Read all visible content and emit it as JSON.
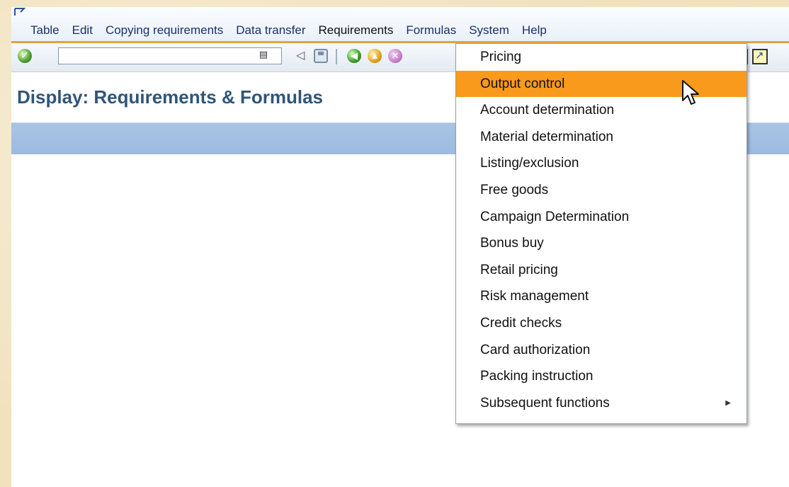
{
  "window": {
    "page_title": "Display: Requirements & Formulas"
  },
  "menubar": {
    "items": [
      {
        "label": "Table"
      },
      {
        "label": "Edit"
      },
      {
        "label": "Copying requirements"
      },
      {
        "label": "Data transfer"
      },
      {
        "label": "Requirements"
      },
      {
        "label": "Formulas"
      },
      {
        "label": "System"
      },
      {
        "label": "Help"
      }
    ],
    "active_index": 4
  },
  "toolbar": {
    "command_field_value": "",
    "icons": [
      "enter-check-icon",
      "command-history-icon",
      "back-triangle-icon",
      "save-icon",
      "back-icon",
      "exit-icon",
      "cancel-icon",
      "layout-icon",
      "create-session-icon"
    ]
  },
  "requirements_menu": {
    "items": [
      {
        "label": "Pricing"
      },
      {
        "label": "Output control"
      },
      {
        "label": "Account determination"
      },
      {
        "label": "Material determination"
      },
      {
        "label": "Listing/exclusion"
      },
      {
        "label": "Free goods"
      },
      {
        "label": "Campaign Determination"
      },
      {
        "label": "Bonus buy"
      },
      {
        "label": "Retail pricing"
      },
      {
        "label": "Risk management"
      },
      {
        "label": "Credit checks"
      },
      {
        "label": "Card authorization"
      },
      {
        "label": "Packing instruction"
      },
      {
        "label": "Subsequent functions",
        "submenu": true
      }
    ],
    "highlighted_index": 1
  },
  "colors": {
    "highlight": "#f99a1c",
    "menu_text": "#1c2f6a",
    "title_text": "#2f5678",
    "app_bar": "#a8c4e4",
    "toolbar_accent": "#e8a23b"
  }
}
